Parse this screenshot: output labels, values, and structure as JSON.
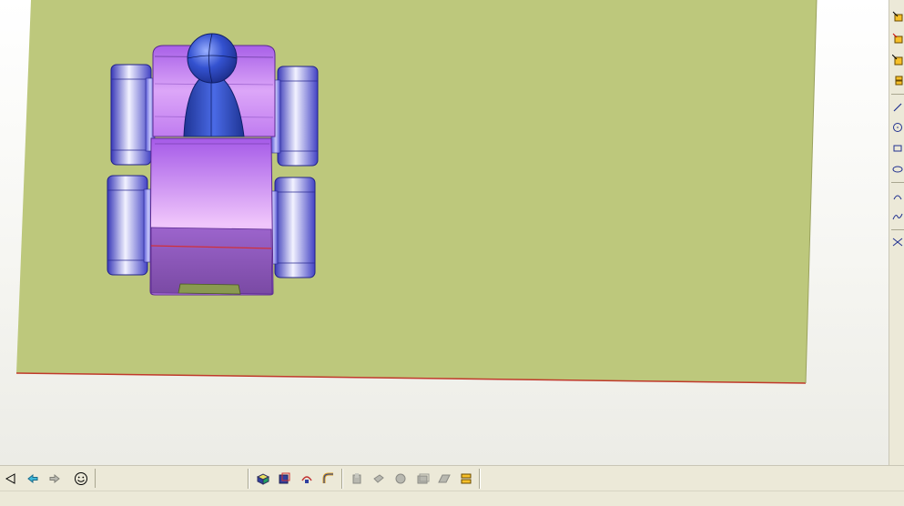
{
  "app": {
    "window_title": ""
  },
  "viewport": {
    "ground_color": "#bdc87c",
    "car_body_color": "#b070e0",
    "driver_color": "#3a5fd0",
    "wheel_color": "#7a7ae6"
  },
  "right_toolbar": {
    "tools": [
      {
        "name": "assembly-constraint-icon"
      },
      {
        "name": "fix-component-icon"
      },
      {
        "name": "snap-component-icon"
      },
      {
        "name": "multi-component-icon"
      },
      {
        "name": "line-tool-icon"
      },
      {
        "name": "circle-tool-icon"
      },
      {
        "name": "rectangle-tool-icon"
      },
      {
        "name": "ellipse-tool-icon"
      },
      {
        "name": "arc-tool-icon"
      },
      {
        "name": "spline-tool-icon"
      },
      {
        "name": "trim-tool-icon"
      }
    ]
  },
  "bottom_toolbar": {
    "nav": [
      {
        "name": "back-icon"
      },
      {
        "name": "previous-icon"
      },
      {
        "name": "next-icon"
      },
      {
        "name": "smiley-icon"
      }
    ],
    "view_tools": [
      {
        "name": "shaded-view-icon"
      },
      {
        "name": "hidden-line-view-icon"
      },
      {
        "name": "rotate-view-icon"
      },
      {
        "name": "sweep-tool-icon"
      }
    ],
    "disabled_tools": [
      {
        "name": "feature-tool-1-icon"
      },
      {
        "name": "feature-tool-2-icon"
      },
      {
        "name": "feature-tool-3-icon"
      },
      {
        "name": "feature-tool-4-icon"
      },
      {
        "name": "feature-tool-5-icon"
      },
      {
        "name": "feature-tool-6-icon"
      }
    ]
  },
  "status_bar": {
    "text": ""
  }
}
